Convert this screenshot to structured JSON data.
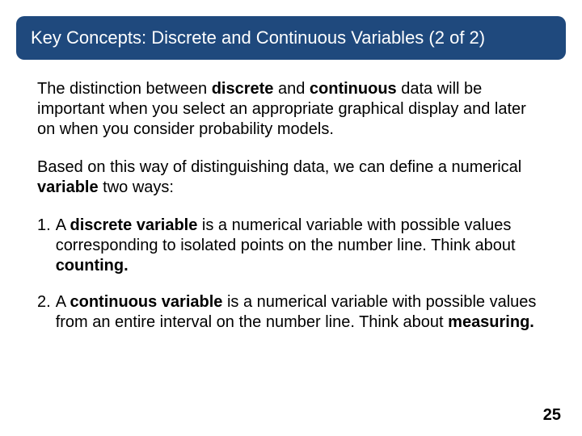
{
  "title": "Key Concepts: Discrete and Continuous Variables (2 of 2)",
  "para1": {
    "t1": "The distinction between ",
    "b1": "discrete",
    "t2": " and ",
    "b2": "continuous",
    "t3": " data will be important when you select an appropriate graphical display and later on when you consider probability models."
  },
  "para2": {
    "t1": "Based on this way of distinguishing data, we can define a numerical ",
    "b1": "variable",
    "t2": " two ways:"
  },
  "item1": {
    "num": "1.",
    "t1": "A ",
    "b1": "discrete variable",
    "t2": " is a numerical variable with possible values corresponding to isolated points on the number line. Think about ",
    "b2": "counting.",
    "t3": ""
  },
  "item2": {
    "num": "2.",
    "t1": "A ",
    "b1": "continuous variable",
    "t2": " is a numerical variable with possible values from an entire interval on the number line. Think about ",
    "b2": "measuring.",
    "t3": ""
  },
  "page": "25"
}
